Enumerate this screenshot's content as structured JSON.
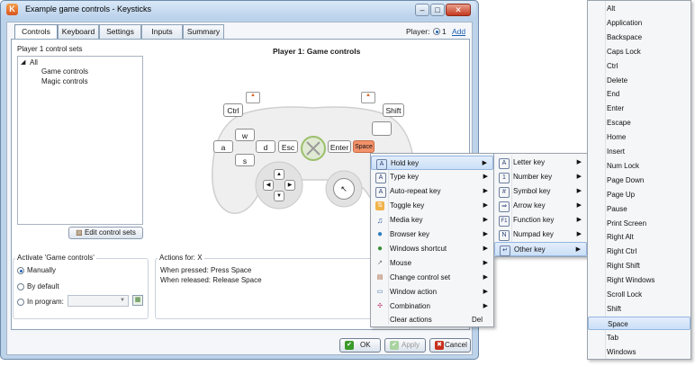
{
  "window": {
    "title": "Example game controls - Keysticks",
    "app_icon": "K",
    "minimize": "–",
    "maximize": "□",
    "close": "✕"
  },
  "tabs": [
    "Controls",
    "Keyboard",
    "Settings",
    "Inputs",
    "Summary"
  ],
  "player": {
    "label": "Player:",
    "value": "1",
    "add": "Add"
  },
  "control_sets": {
    "heading": "Player 1 control sets",
    "root": "All",
    "children": [
      "Game controls",
      "Magic controls"
    ],
    "edit_button": "Edit control sets"
  },
  "activate": {
    "title": "Activate 'Game controls'",
    "options": [
      "Manually",
      "By default",
      "In program:"
    ],
    "selected": "Manually"
  },
  "actions": {
    "title": "Actions for: X",
    "pressed": "When pressed: Press Space",
    "released": "When released: Release Space"
  },
  "controller": {
    "title": "Player 1: Game controls",
    "keys": {
      "ctrl": "Ctrl",
      "shift": "Shift",
      "w": "w",
      "a": "a",
      "s": "s",
      "d": "d",
      "esc": "Esc",
      "enter": "Enter",
      "space": "Space"
    }
  },
  "context_menu": {
    "items": [
      {
        "label": "Hold key",
        "icon": "A",
        "submenu": true
      },
      {
        "label": "Type key",
        "icon": "A",
        "submenu": true
      },
      {
        "label": "Auto-repeat key",
        "icon": "A",
        "submenu": true
      },
      {
        "label": "Toggle key",
        "icon": "⇅",
        "submenu": true
      },
      {
        "label": "Media key",
        "icon": "♫",
        "submenu": true
      },
      {
        "label": "Browser key",
        "icon": "●",
        "submenu": true
      },
      {
        "label": "Windows shortcut",
        "icon": "●",
        "submenu": true
      },
      {
        "label": "Mouse",
        "icon": "↗",
        "submenu": true
      },
      {
        "label": "Change control set",
        "icon": "▤",
        "submenu": true
      },
      {
        "label": "Window action",
        "icon": "▭",
        "submenu": true
      },
      {
        "label": "Combination",
        "icon": "✣",
        "submenu": true
      },
      {
        "label": "Clear actions",
        "icon": "",
        "submenu": false,
        "shortcut": "Del"
      }
    ]
  },
  "key_submenu": {
    "items": [
      {
        "label": "Letter key",
        "icon": "A"
      },
      {
        "label": "Number key",
        "icon": "1"
      },
      {
        "label": "Symbol key",
        "icon": "#"
      },
      {
        "label": "Arrow key",
        "icon": "⇒"
      },
      {
        "label": "Function key",
        "icon": "F1"
      },
      {
        "label": "Numpad key",
        "icon": "N"
      },
      {
        "label": "Other key",
        "icon": "↵"
      }
    ]
  },
  "other_keys": [
    "Alt",
    "Application",
    "Backspace",
    "Caps Lock",
    "Ctrl",
    "Delete",
    "End",
    "Enter",
    "Escape",
    "Home",
    "Insert",
    "Num Lock",
    "Page Down",
    "Page Up",
    "Pause",
    "Print Screen",
    "Right Alt",
    "Right Ctrl",
    "Right Shift",
    "Right Windows",
    "Scroll Lock",
    "Shift",
    "Space",
    "Tab",
    "Windows"
  ],
  "other_keys_selected": "Space",
  "buttons": {
    "ok": "OK",
    "apply": "Apply",
    "cancel": "Cancel"
  },
  "colors": {
    "accent": "#1c5fb3",
    "space_key": "#f2916a",
    "ok_icon": "#3a9a2a",
    "cancel_icon": "#c7301b"
  }
}
